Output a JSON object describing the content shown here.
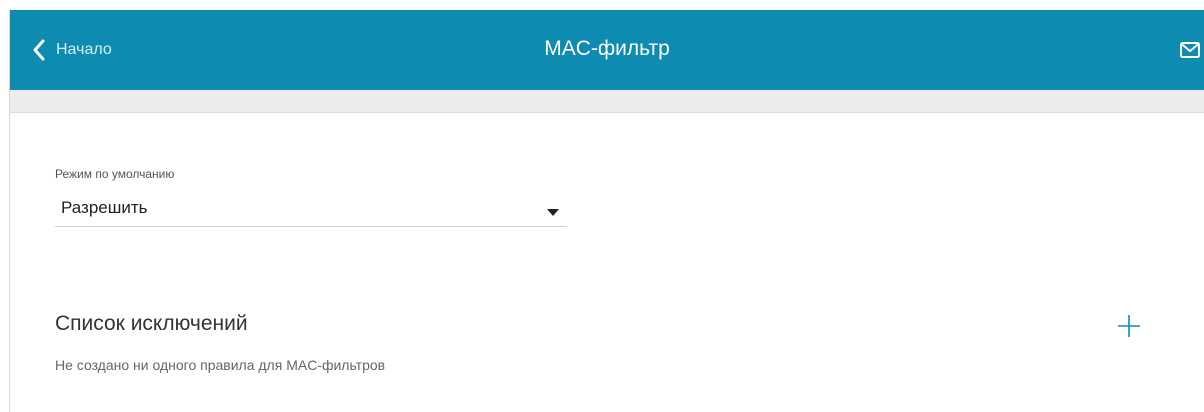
{
  "header": {
    "back_label": "Начало",
    "title": "MAC-фильтр",
    "back_icon": "chevron-left-icon",
    "mail_icon": "mail-icon",
    "background_color": "#0e8bb0"
  },
  "default_mode": {
    "caption": "Режим по умолчанию",
    "value": "Разрешить",
    "arrow_icon": "caret-down-icon"
  },
  "exceptions": {
    "title": "Список исключений",
    "add_icon": "plus-icon",
    "empty_message": "Не создано ни одного правила для MAC-фильтров"
  }
}
